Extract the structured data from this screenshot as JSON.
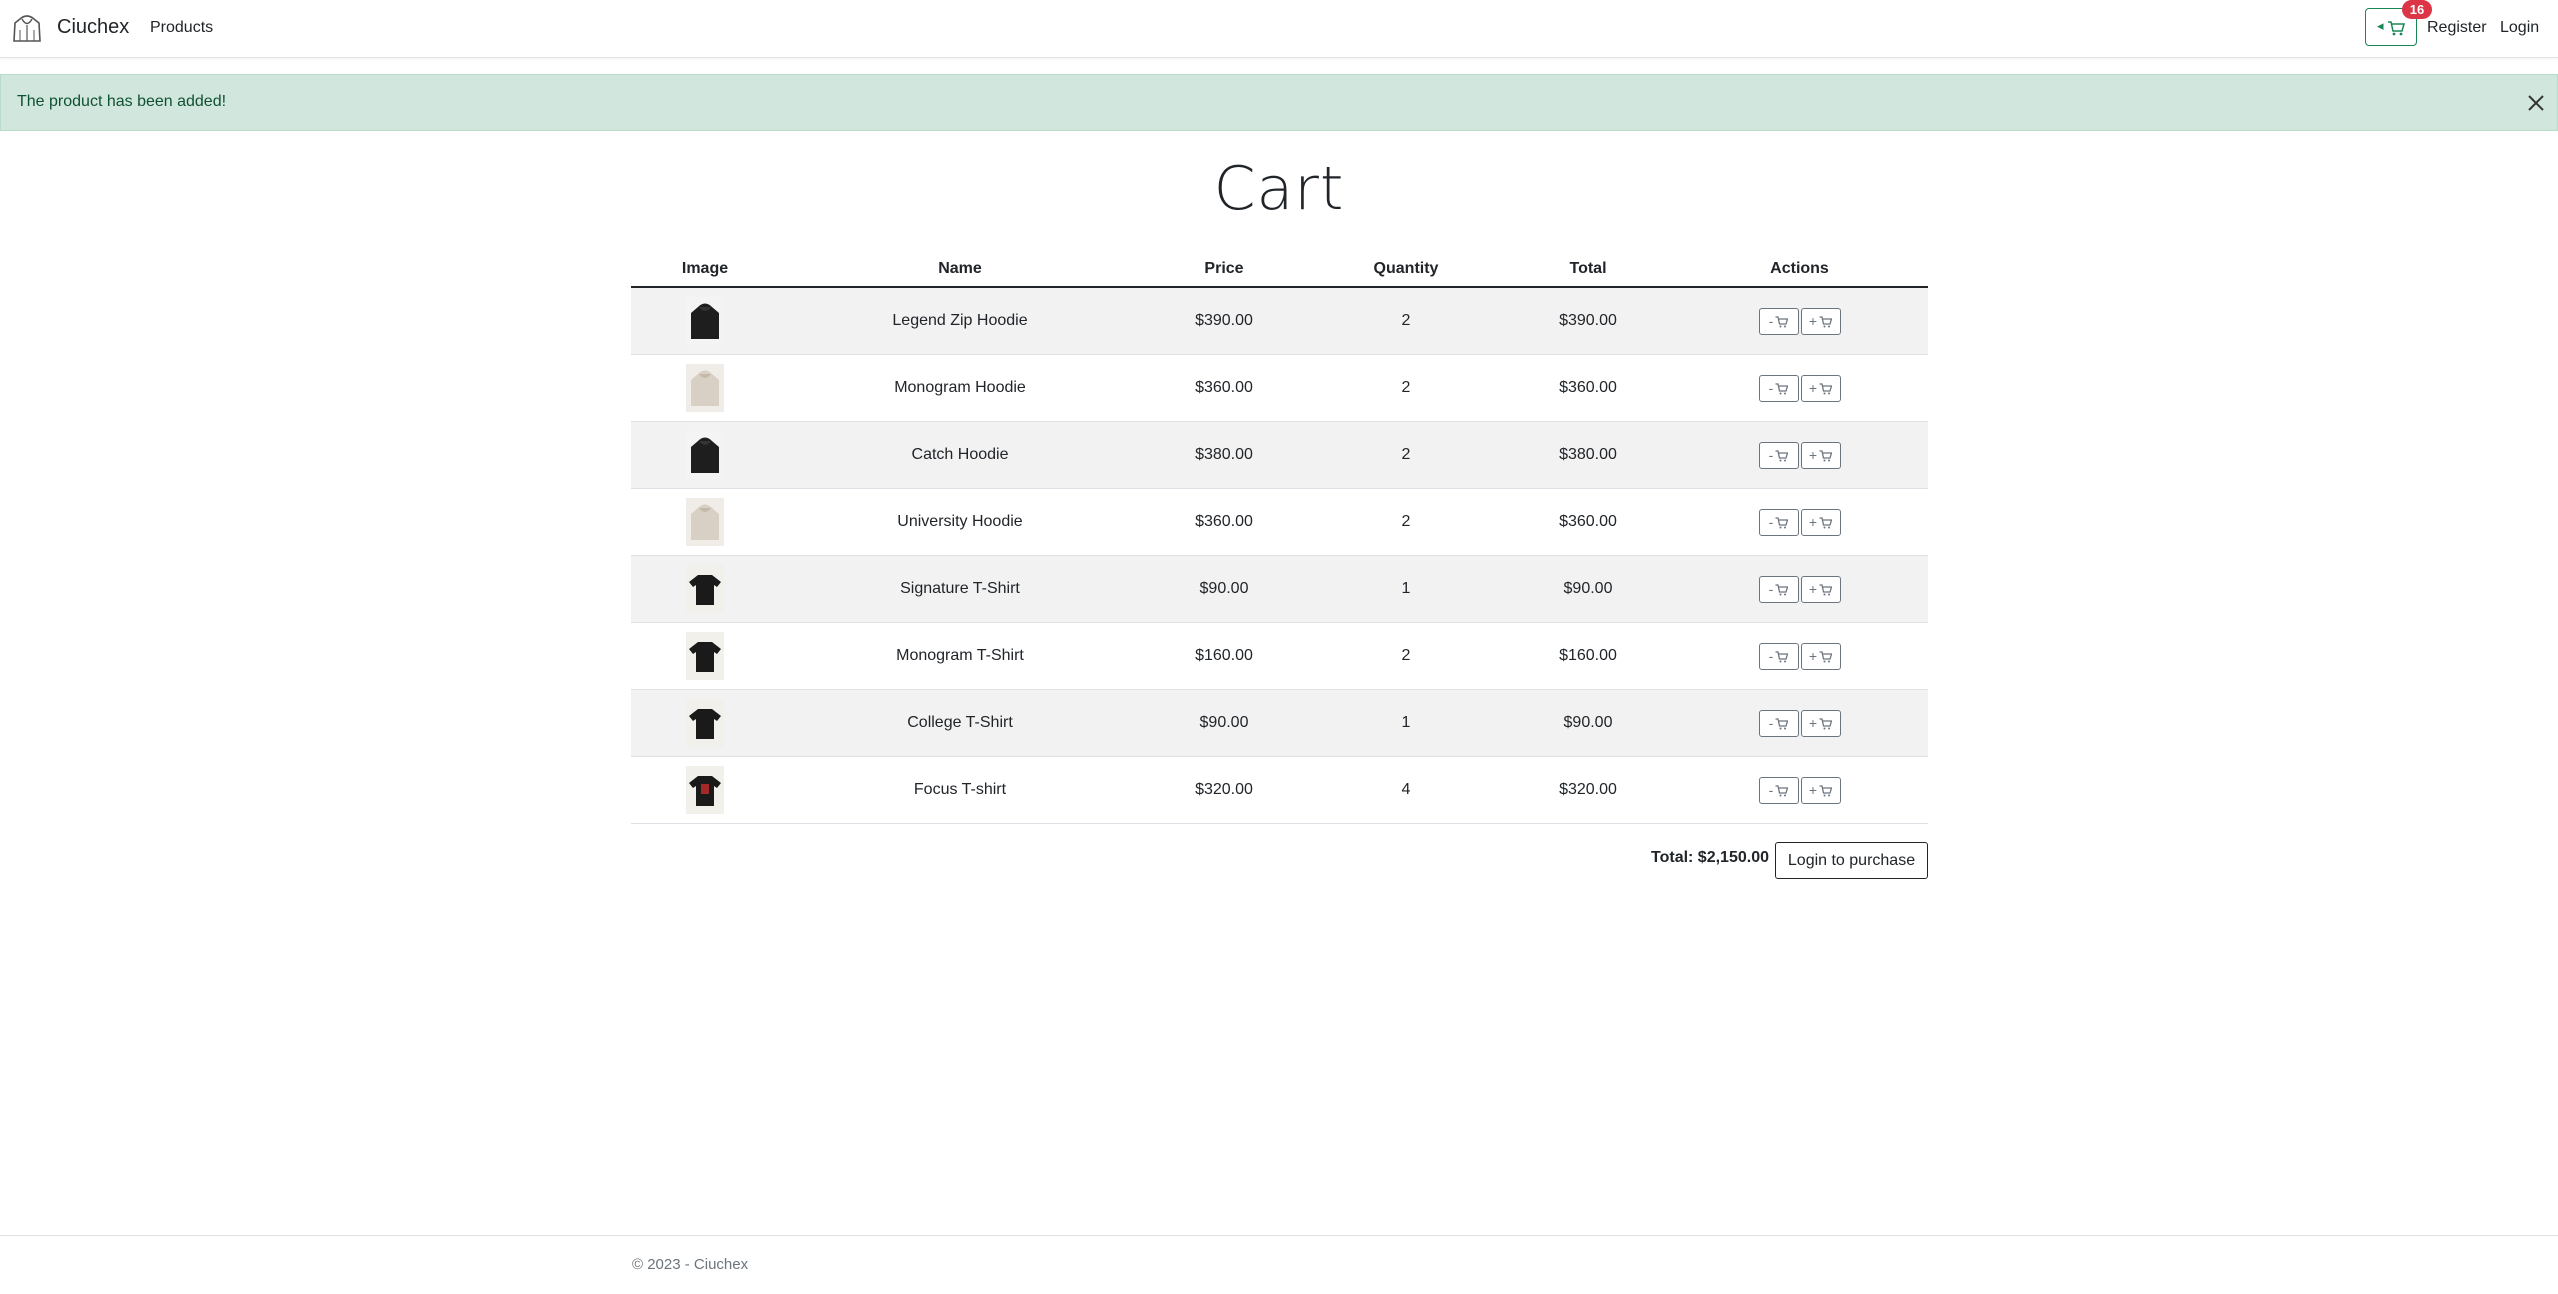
{
  "navbar": {
    "brand": "Ciuchex",
    "logo_icon": "hoodie-icon",
    "links": {
      "products": "Products",
      "register": "Register",
      "login": "Login"
    },
    "cart_badge": "16",
    "cart_icon": "cart-icon"
  },
  "alert": {
    "message": "The product has been added!",
    "close_icon": "close-icon",
    "color": "#d1e7dd"
  },
  "page": {
    "title": "Cart"
  },
  "table": {
    "headers": [
      "Image",
      "Name",
      "Price",
      "Quantity",
      "Total",
      "Actions"
    ],
    "rows": [
      {
        "name": "Legend Zip Hoodie",
        "price": "$390.00",
        "quantity": "2",
        "total": "$390.00",
        "thumb": "dark-hoodie"
      },
      {
        "name": "Monogram Hoodie",
        "price": "$360.00",
        "quantity": "2",
        "total": "$360.00",
        "thumb": "beige-hoodie"
      },
      {
        "name": "Catch Hoodie",
        "price": "$380.00",
        "quantity": "2",
        "total": "$380.00",
        "thumb": "dark-hoodie"
      },
      {
        "name": "University Hoodie",
        "price": "$360.00",
        "quantity": "2",
        "total": "$360.00",
        "thumb": "beige-hoodie"
      },
      {
        "name": "Signature T-Shirt",
        "price": "$90.00",
        "quantity": "1",
        "total": "$90.00",
        "thumb": "black-tshirt"
      },
      {
        "name": "Monogram T-Shirt",
        "price": "$160.00",
        "quantity": "2",
        "total": "$160.00",
        "thumb": "black-tshirt"
      },
      {
        "name": "College T-Shirt",
        "price": "$90.00",
        "quantity": "1",
        "total": "$90.00",
        "thumb": "black-tshirt"
      },
      {
        "name": "Focus T-shirt",
        "price": "$320.00",
        "quantity": "4",
        "total": "$320.00",
        "thumb": "black-red-tshirt"
      }
    ],
    "actions": {
      "decrease": "-",
      "increase": "+"
    }
  },
  "summary": {
    "total": "Total: $2,150.00",
    "purchase_button": "Login to purchase"
  },
  "footer": {
    "text": "© 2023 - Ciuchex"
  },
  "colors": {
    "accent_success": "#198754",
    "badge": "#dc3545",
    "striped_row": "#f2f2f2"
  }
}
